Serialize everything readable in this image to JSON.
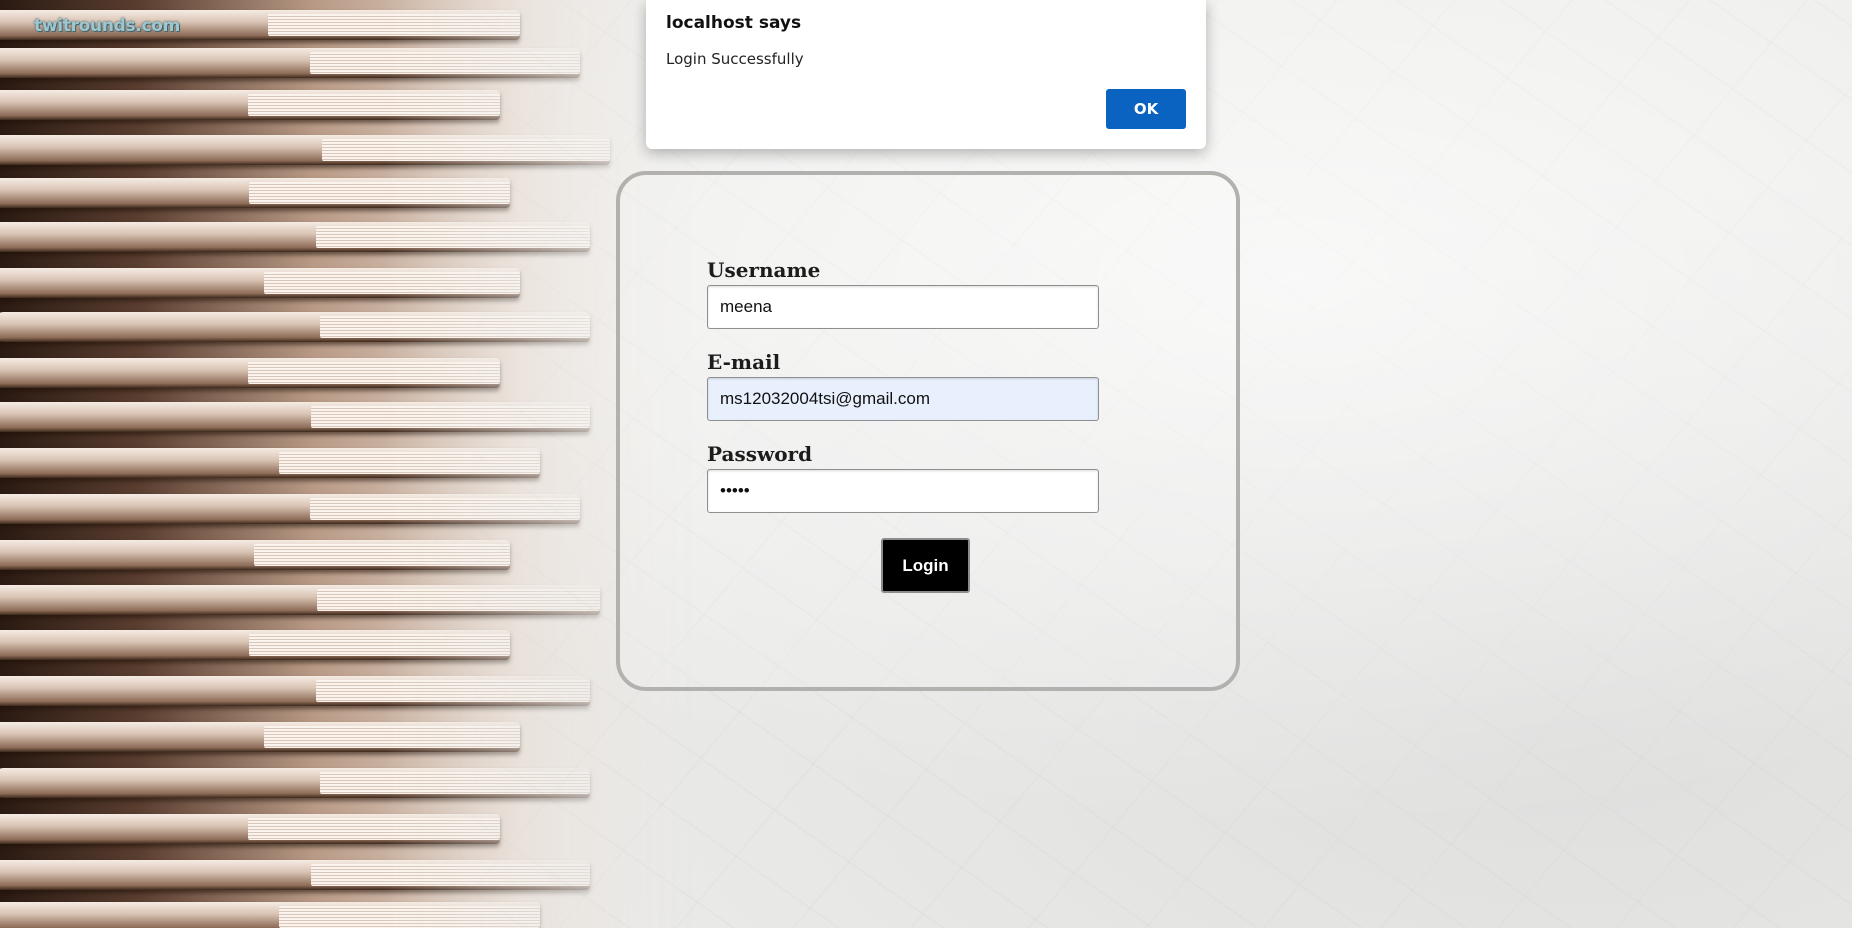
{
  "brand": {
    "text": "twitrounds.com"
  },
  "dialog": {
    "title": "localhost says",
    "message": "Login Successfully",
    "ok_label": "OK"
  },
  "form": {
    "username": {
      "label": "Username",
      "value": "meena"
    },
    "email": {
      "label": "E-mail",
      "value": "ms12032004tsi@gmail.com"
    },
    "password": {
      "label": "Password",
      "value": "•••••"
    },
    "login_label": "Login"
  },
  "colors": {
    "dialog_ok": "#0b63c1",
    "login_button": "#000000",
    "autofill": "#e8f0fe"
  }
}
